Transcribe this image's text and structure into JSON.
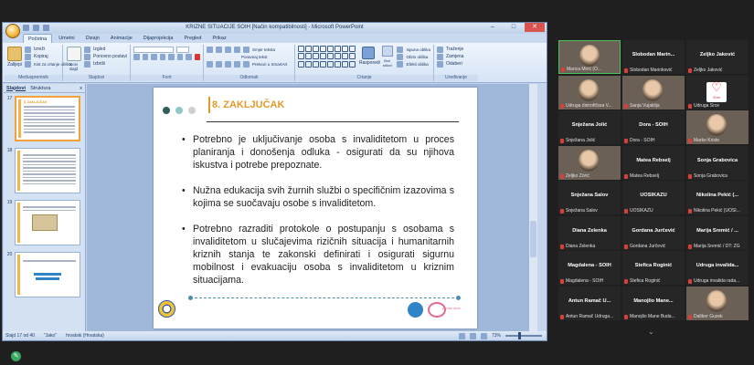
{
  "window": {
    "title": "KRIZNE SITUACIJE SOIH [Način kompatibilnosti] - Microsoft PowerPoint",
    "controls": [
      "–",
      "□",
      "✕"
    ]
  },
  "ribbon_tabs": [
    "Početna",
    "Umetni",
    "Dizajn",
    "Animacije",
    "Dijaprojekcija",
    "Pregled",
    "Prikaz"
  ],
  "active_tab": "Početna",
  "ribbon": {
    "clipboard": {
      "paste": "Zalijepi",
      "cut": "Izreži",
      "copy": "Kopiraj",
      "format_painter": "Kist za crtanje oblika",
      "label": "Međuspremnik"
    },
    "slides": {
      "new_slide": "Novi slajd",
      "layout": "Izgled",
      "reset": "Ponovno postavi",
      "delete": "Izbriši",
      "label": "Slajdovi"
    },
    "font": {
      "label": "Font"
    },
    "paragraph": {
      "label": "Odlomak",
      "text_direction": "Smjer teksta",
      "align_text": "Poravnaj tekst",
      "smartart": "Pretvori u SmartArt"
    },
    "drawing": {
      "arrange": "Rasporedi",
      "quick_styles": "Brzi stilovi",
      "fill": "Ispuna oblika",
      "outline": "Obris oblika",
      "effects": "Efekti oblika",
      "label": "Crtanje"
    },
    "editing": {
      "find": "Traženje",
      "replace": "Zamjena",
      "select": "Odaberi",
      "label": "Uređivanje"
    }
  },
  "panel": {
    "tabs": [
      "Slajdovi",
      "Struktura"
    ],
    "close": "x"
  },
  "thumbnails": [
    {
      "num": "17",
      "title": "8. ZAKLJUČAK",
      "selected": true
    },
    {
      "num": "18",
      "title": "",
      "selected": false
    },
    {
      "num": "19",
      "title": "",
      "selected": false
    },
    {
      "num": "20",
      "title": "",
      "selected": false
    }
  ],
  "slide": {
    "title": "8. ZAKLJUČAK",
    "bullets": [
      "Potrebno je uključivanje osoba s invaliditetom u proces planiranja i donošenja odluka - osigurati da su njihova iskustva i potrebe prepoznate.",
      "Nužna edukacija svih žurnih službi o specifičnim izazovima s kojima se suočavaju osobe s invaliditetom.",
      "Potrebno razraditi protokole o postupanju s osobama s invaliditetom u slučajevima rizičnih situacija i humanitarnih kriznih stanja te zakonski definirati i osigurati sigurnu mobilnost i evakuaciju osoba s invaliditetom u kriznim situacijama."
    ],
    "dot_colors": [
      "#2f5f5a",
      "#8fc7c6",
      "#d0d0d0"
    ],
    "accent": "#e39a2c",
    "logo_text": "centar srce"
  },
  "statusbar": {
    "slide_info": "Slajd 17 od 40",
    "theme": "\"Jako\"",
    "language": "hrvatski (Hrvatska)",
    "zoom": "73%"
  },
  "participants": [
    {
      "name": "",
      "label": "Marica Mirić (O...",
      "type": "video",
      "speaking": true
    },
    {
      "name": "Slobodan Marin...",
      "label": "Slobodan Marinković",
      "type": "name"
    },
    {
      "name": "Željko Jaković",
      "label": "Željko Jaković",
      "type": "name"
    },
    {
      "name": "",
      "label": "Udruga distrofičara V...",
      "type": "video"
    },
    {
      "name": "",
      "label": "Sanja Vujaklija",
      "type": "video"
    },
    {
      "name": "",
      "label": "Udruga Srce",
      "type": "logo"
    },
    {
      "name": "Snježana Jolić",
      "label": "Snježana Jolić",
      "type": "name"
    },
    {
      "name": "Dora - SOIH",
      "label": "Dora - SOIH",
      "type": "name"
    },
    {
      "name": "",
      "label": "Marko Kriste",
      "type": "video"
    },
    {
      "name": "",
      "label": "Željko Zorić",
      "type": "video"
    },
    {
      "name": "Matea Rebselj",
      "label": "Matea Rebselj",
      "type": "name"
    },
    {
      "name": "Sonja Grabovica",
      "label": "Sonja Grabovica",
      "type": "name"
    },
    {
      "name": "Snježana Šalov",
      "label": "Snježana Šalov",
      "type": "name"
    },
    {
      "name": "UOSIKAŽU",
      "label": "UOSIKAŽU",
      "type": "name"
    },
    {
      "name": "Nikolina Pekić (...",
      "label": "Nikolina Pekić (UOSI...",
      "type": "name"
    },
    {
      "name": "Diana Zelenka",
      "label": "Diana Zelenka",
      "type": "name"
    },
    {
      "name": "Gordana Jurčević",
      "label": "Gordana Jurčević",
      "type": "name"
    },
    {
      "name": "Marija Sremić / ...",
      "label": "Marija Sremić / DT: ZG",
      "type": "name"
    },
    {
      "name": "Magdalena - SOIH",
      "label": "Magdalena - SOIH",
      "type": "name"
    },
    {
      "name": "Štefica Roginić",
      "label": "Štefica Roginić",
      "type": "name"
    },
    {
      "name": "Udruga invalida...",
      "label": "Udruga invalida rada...",
      "type": "name"
    },
    {
      "name": "Antun Ramač U...",
      "label": "Antun Ramač Udruga...",
      "type": "name"
    },
    {
      "name": "Manojlio Mane...",
      "label": "Manojlio Mane Buda...",
      "type": "name"
    },
    {
      "name": "",
      "label": "Dalibor Guzek",
      "type": "video"
    }
  ]
}
